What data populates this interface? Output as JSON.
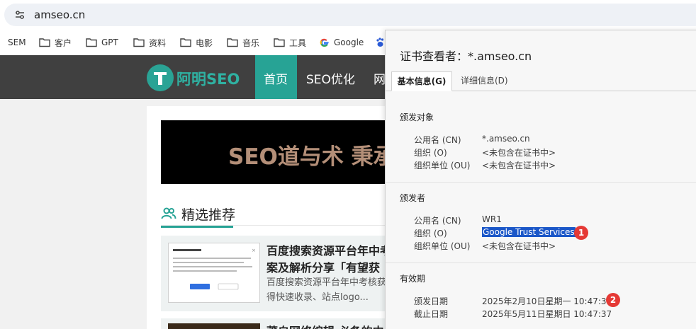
{
  "browser": {
    "url": "amseo.cn",
    "bookmarks": [
      {
        "label": "SEM",
        "icon": "folder-icon"
      },
      {
        "label": "客户",
        "icon": "folder-icon"
      },
      {
        "label": "GPT",
        "icon": "folder-icon"
      },
      {
        "label": "资料",
        "icon": "folder-icon"
      },
      {
        "label": "电影",
        "icon": "folder-icon"
      },
      {
        "label": "音乐",
        "icon": "folder-icon"
      },
      {
        "label": "工具",
        "icon": "folder-icon"
      },
      {
        "label": "Google",
        "icon": "google-icon"
      },
      {
        "label": "",
        "icon": "baidu-icon"
      }
    ]
  },
  "site": {
    "logo_text": "阿明SEO",
    "nav": [
      "首页",
      "SEO优化",
      "网"
    ],
    "banner_text": "SEO道与术 秉承",
    "section_title": "精选推荐",
    "article": {
      "title": "百度搜索资源平台年中考案及解析分享「有望获",
      "desc": "百度搜索资源平台年中考核获得快速收录、站点logo..."
    },
    "article2_title": "莆自网络编辑 必备的内"
  },
  "cert": {
    "title": "证书查看者：*.amseo.cn",
    "tabs": [
      "基本信息(G)",
      "详细信息(D)"
    ],
    "issued_to": {
      "heading": "颁发对象",
      "rows": [
        {
          "label": "公用名 (CN)",
          "value": "*.amseo.cn"
        },
        {
          "label": "组织 (O)",
          "value": "<未包含在证书中>"
        },
        {
          "label": "组织单位 (OU)",
          "value": "<未包含在证书中>"
        }
      ]
    },
    "issued_by": {
      "heading": "颁发者",
      "rows": [
        {
          "label": "公用名 (CN)",
          "value": "WR1"
        },
        {
          "label": "组织 (O)",
          "value": "Google Trust Services"
        },
        {
          "label": "组织单位 (OU)",
          "value": "<未包含在证书中>"
        }
      ]
    },
    "validity": {
      "heading": "有效期",
      "rows": [
        {
          "label": "颁发日期",
          "value": "2025年2月10日星期一 10:47:38"
        },
        {
          "label": "截止日期",
          "value": "2025年5月11日星期日 10:47:37"
        }
      ]
    },
    "badges": [
      "1",
      "2"
    ]
  },
  "colors": {
    "accent": "#27a395",
    "header_bg": "#404040",
    "highlight": "#1b57c8",
    "badge": "#e53935"
  }
}
